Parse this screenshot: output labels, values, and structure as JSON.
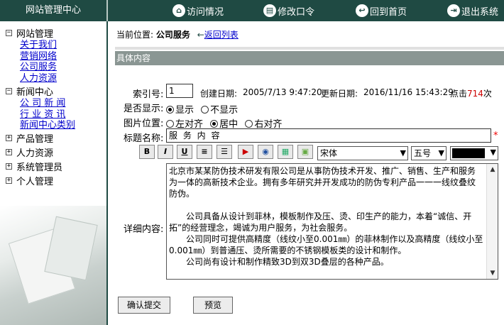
{
  "header": {
    "brand": "网站管理中心",
    "nav": [
      {
        "icon": "visit-icon",
        "label": "访问情况"
      },
      {
        "icon": "password-icon",
        "label": "修改口令"
      },
      {
        "icon": "home-icon",
        "label": "回到首页"
      },
      {
        "icon": "exit-icon",
        "label": "退出系统"
      }
    ]
  },
  "sidebar": {
    "groups": [
      {
        "label": "网站管理",
        "expanded": true,
        "children": [
          "关于我们",
          "营销网络",
          "公司服务",
          "人力资源"
        ]
      },
      {
        "label": "新闻中心",
        "expanded": true,
        "children": [
          "公 司 新 闻",
          "行 业 资 讯",
          "新闻中心类别"
        ]
      },
      {
        "label": "产品管理",
        "expanded": false,
        "children": []
      },
      {
        "label": "人力资源",
        "expanded": false,
        "children": []
      },
      {
        "label": "系统管理员",
        "expanded": false,
        "children": []
      },
      {
        "label": "个人管理",
        "expanded": false,
        "children": []
      }
    ]
  },
  "breadcrumb": {
    "prefix": "当前位置:",
    "current": "公司服务",
    "back_label": "返回列表"
  },
  "section_title": "具体内容",
  "form": {
    "index_label": "索引号:",
    "index_value": "1",
    "created_label": "创建日期:",
    "created_value": "2005/7/13 9:47:20",
    "updated_label": "更新日期:",
    "updated_value": "2016/11/16 15:43:29",
    "clicks_label": "点击",
    "clicks_value": "714",
    "clicks_unit": "次",
    "display_label": "是否显示:",
    "display_options": [
      "显示",
      "不显示"
    ],
    "display_selected": "显示",
    "position_label": "图片位置:",
    "position_options": [
      "左对齐",
      "居中",
      "右对齐"
    ],
    "position_selected": "居中",
    "title_label": "标题名称:",
    "title_value": "服 务 内 容",
    "required_mark": "*",
    "content_label": "详细内容:",
    "toolbar": {
      "bold": "B",
      "italic": "I",
      "underline": "U",
      "font_value": "宋体",
      "size_value": "五号"
    },
    "content_paragraphs": [
      "北京市某某防伪技术研发有限公司是从事防伪技术开发、推广、销售、生产和服务为一体的高新技术企业。拥有多年研究并开发成功的防伪专利产品一一一线纹叠纹防伪。",
      "",
      "　　公司具备从设计到菲林，模板制作及压、烫、印生产的能力，本着“诚信、开拓”的经营理念，竭诚为用户服务，为社会服务。",
      "　　公司同时可提供高精度（线纹小至0.001㎜）的菲林制作以及高精度（线纹小至0.001㎜）到普通压、烫所需要的不锈钢模板类的设计和制作。",
      "　　公司尚有设计和制作精致3D到双3D叠层的各种产品。"
    ]
  },
  "buttons": {
    "submit": "确认提交",
    "preview": "预览"
  },
  "colors": {
    "header_bg": "#1f4a43",
    "section_bar": "#8a9693",
    "link": "#0000cc",
    "click_count": "#cc0000"
  }
}
